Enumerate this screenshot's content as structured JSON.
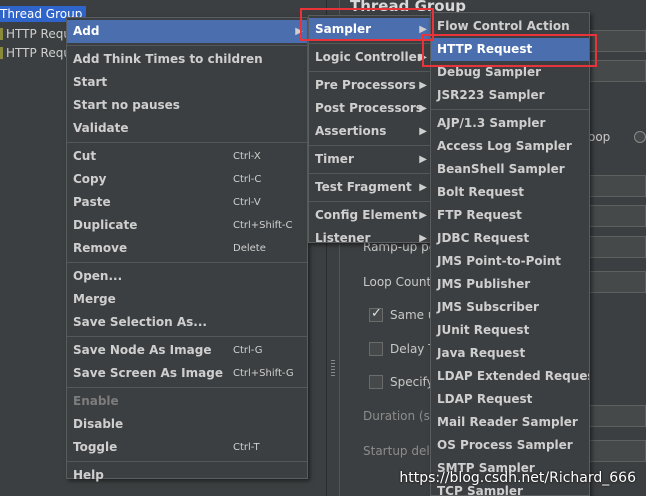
{
  "tree": {
    "selected_node": "Thread Group",
    "nodes": [
      "HTTP Requ",
      "HTTP Requ"
    ]
  },
  "content": {
    "title": "Thread Group",
    "loop_suffix": "oop",
    "rampup_label": "Ramp-up pe",
    "loop_count_label": "Loop Count:",
    "same_user_label": "Same u",
    "delay_label": "Delay T",
    "specify_label": "Specify",
    "duration_label": "Duration (se",
    "startup_label": "Startup dela"
  },
  "menu_main": {
    "add": "Add",
    "add_think_times": "Add Think Times to children",
    "start": "Start",
    "start_no_pauses": "Start no pauses",
    "validate": "Validate",
    "cut": "Cut",
    "cut_sc": "Ctrl-X",
    "copy": "Copy",
    "copy_sc": "Ctrl-C",
    "paste": "Paste",
    "paste_sc": "Ctrl-V",
    "duplicate": "Duplicate",
    "duplicate_sc": "Ctrl+Shift-C",
    "remove": "Remove",
    "remove_sc": "Delete",
    "open": "Open...",
    "merge": "Merge",
    "save_selection": "Save Selection As...",
    "save_node_image": "Save Node As Image",
    "save_node_image_sc": "Ctrl-G",
    "save_screen_image": "Save Screen As Image",
    "save_screen_image_sc": "Ctrl+Shift-G",
    "enable": "Enable",
    "disable": "Disable",
    "toggle": "Toggle",
    "toggle_sc": "Ctrl-T",
    "help": "Help"
  },
  "menu_add": {
    "sampler": "Sampler",
    "logic_controller": "Logic Controller",
    "pre_processors": "Pre Processors",
    "post_processors": "Post Processors",
    "assertions": "Assertions",
    "timer": "Timer",
    "test_fragment": "Test Fragment",
    "config_element": "Config Element",
    "listener": "Listener"
  },
  "menu_sampler": {
    "items": [
      "Flow Control Action",
      "HTTP Request",
      "Debug Sampler",
      "JSR223 Sampler",
      "AJP/1.3 Sampler",
      "Access Log Sampler",
      "BeanShell Sampler",
      "Bolt Request",
      "FTP Request",
      "JDBC Request",
      "JMS Point-to-Point",
      "JMS Publisher",
      "JMS Subscriber",
      "JUnit Request",
      "Java Request",
      "LDAP Extended Request",
      "LDAP Request",
      "Mail Reader Sampler",
      "OS Process Sampler",
      "SMTP Sampler",
      "TCP Sampler"
    ]
  },
  "icons": {
    "submenu": "arrow-right-icon",
    "check": "check-icon"
  },
  "colors": {
    "highlight": "#4b6eaf",
    "annotation": "#e8333a",
    "background": "#3c3f41"
  },
  "watermark": "https://blog.csdn.net/Richard_666"
}
